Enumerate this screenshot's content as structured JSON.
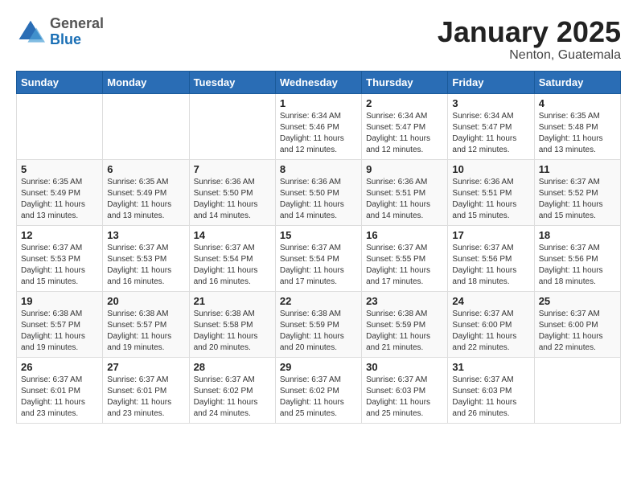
{
  "logo": {
    "general": "General",
    "blue": "Blue"
  },
  "header": {
    "month": "January 2025",
    "location": "Nenton, Guatemala"
  },
  "weekdays": [
    "Sunday",
    "Monday",
    "Tuesday",
    "Wednesday",
    "Thursday",
    "Friday",
    "Saturday"
  ],
  "weeks": [
    [
      {
        "day": "",
        "info": ""
      },
      {
        "day": "",
        "info": ""
      },
      {
        "day": "",
        "info": ""
      },
      {
        "day": "1",
        "info": "Sunrise: 6:34 AM\nSunset: 5:46 PM\nDaylight: 11 hours\nand 12 minutes."
      },
      {
        "day": "2",
        "info": "Sunrise: 6:34 AM\nSunset: 5:47 PM\nDaylight: 11 hours\nand 12 minutes."
      },
      {
        "day": "3",
        "info": "Sunrise: 6:34 AM\nSunset: 5:47 PM\nDaylight: 11 hours\nand 12 minutes."
      },
      {
        "day": "4",
        "info": "Sunrise: 6:35 AM\nSunset: 5:48 PM\nDaylight: 11 hours\nand 13 minutes."
      }
    ],
    [
      {
        "day": "5",
        "info": "Sunrise: 6:35 AM\nSunset: 5:49 PM\nDaylight: 11 hours\nand 13 minutes."
      },
      {
        "day": "6",
        "info": "Sunrise: 6:35 AM\nSunset: 5:49 PM\nDaylight: 11 hours\nand 13 minutes."
      },
      {
        "day": "7",
        "info": "Sunrise: 6:36 AM\nSunset: 5:50 PM\nDaylight: 11 hours\nand 14 minutes."
      },
      {
        "day": "8",
        "info": "Sunrise: 6:36 AM\nSunset: 5:50 PM\nDaylight: 11 hours\nand 14 minutes."
      },
      {
        "day": "9",
        "info": "Sunrise: 6:36 AM\nSunset: 5:51 PM\nDaylight: 11 hours\nand 14 minutes."
      },
      {
        "day": "10",
        "info": "Sunrise: 6:36 AM\nSunset: 5:51 PM\nDaylight: 11 hours\nand 15 minutes."
      },
      {
        "day": "11",
        "info": "Sunrise: 6:37 AM\nSunset: 5:52 PM\nDaylight: 11 hours\nand 15 minutes."
      }
    ],
    [
      {
        "day": "12",
        "info": "Sunrise: 6:37 AM\nSunset: 5:53 PM\nDaylight: 11 hours\nand 15 minutes."
      },
      {
        "day": "13",
        "info": "Sunrise: 6:37 AM\nSunset: 5:53 PM\nDaylight: 11 hours\nand 16 minutes."
      },
      {
        "day": "14",
        "info": "Sunrise: 6:37 AM\nSunset: 5:54 PM\nDaylight: 11 hours\nand 16 minutes."
      },
      {
        "day": "15",
        "info": "Sunrise: 6:37 AM\nSunset: 5:54 PM\nDaylight: 11 hours\nand 17 minutes."
      },
      {
        "day": "16",
        "info": "Sunrise: 6:37 AM\nSunset: 5:55 PM\nDaylight: 11 hours\nand 17 minutes."
      },
      {
        "day": "17",
        "info": "Sunrise: 6:37 AM\nSunset: 5:56 PM\nDaylight: 11 hours\nand 18 minutes."
      },
      {
        "day": "18",
        "info": "Sunrise: 6:37 AM\nSunset: 5:56 PM\nDaylight: 11 hours\nand 18 minutes."
      }
    ],
    [
      {
        "day": "19",
        "info": "Sunrise: 6:38 AM\nSunset: 5:57 PM\nDaylight: 11 hours\nand 19 minutes."
      },
      {
        "day": "20",
        "info": "Sunrise: 6:38 AM\nSunset: 5:57 PM\nDaylight: 11 hours\nand 19 minutes."
      },
      {
        "day": "21",
        "info": "Sunrise: 6:38 AM\nSunset: 5:58 PM\nDaylight: 11 hours\nand 20 minutes."
      },
      {
        "day": "22",
        "info": "Sunrise: 6:38 AM\nSunset: 5:59 PM\nDaylight: 11 hours\nand 20 minutes."
      },
      {
        "day": "23",
        "info": "Sunrise: 6:38 AM\nSunset: 5:59 PM\nDaylight: 11 hours\nand 21 minutes."
      },
      {
        "day": "24",
        "info": "Sunrise: 6:37 AM\nSunset: 6:00 PM\nDaylight: 11 hours\nand 22 minutes."
      },
      {
        "day": "25",
        "info": "Sunrise: 6:37 AM\nSunset: 6:00 PM\nDaylight: 11 hours\nand 22 minutes."
      }
    ],
    [
      {
        "day": "26",
        "info": "Sunrise: 6:37 AM\nSunset: 6:01 PM\nDaylight: 11 hours\nand 23 minutes."
      },
      {
        "day": "27",
        "info": "Sunrise: 6:37 AM\nSunset: 6:01 PM\nDaylight: 11 hours\nand 23 minutes."
      },
      {
        "day": "28",
        "info": "Sunrise: 6:37 AM\nSunset: 6:02 PM\nDaylight: 11 hours\nand 24 minutes."
      },
      {
        "day": "29",
        "info": "Sunrise: 6:37 AM\nSunset: 6:02 PM\nDaylight: 11 hours\nand 25 minutes."
      },
      {
        "day": "30",
        "info": "Sunrise: 6:37 AM\nSunset: 6:03 PM\nDaylight: 11 hours\nand 25 minutes."
      },
      {
        "day": "31",
        "info": "Sunrise: 6:37 AM\nSunset: 6:03 PM\nDaylight: 11 hours\nand 26 minutes."
      },
      {
        "day": "",
        "info": ""
      }
    ]
  ]
}
